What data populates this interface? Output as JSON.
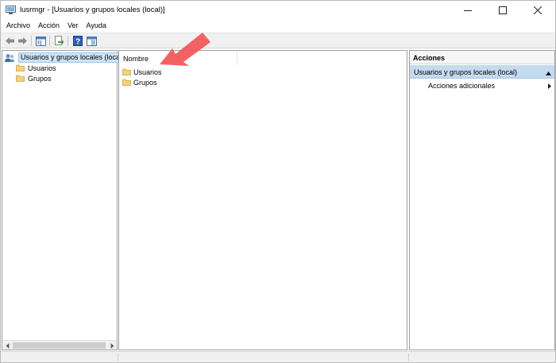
{
  "window": {
    "title": "lusrmgr - [Usuarios y grupos locales (local)]",
    "controls": {
      "minimize": "─",
      "maximize": "☐",
      "close": "✕"
    }
  },
  "menu": [
    "Archivo",
    "Acción",
    "Ver",
    "Ayuda"
  ],
  "toolbar": {
    "buttons": [
      "back-arrow-icon",
      "forward-arrow-icon",
      "show-hide-tree-icon",
      "export-list-icon",
      "help-icon",
      "action-pane-icon"
    ]
  },
  "tree": {
    "root": "Usuarios y grupos locales (local)",
    "children": [
      "Usuarios",
      "Grupos"
    ]
  },
  "list": {
    "column_name": "Nombre",
    "items": [
      "Usuarios",
      "Grupos"
    ]
  },
  "actions": {
    "header": "Acciones",
    "section": "Usuarios y grupos locales (local)",
    "items": [
      "Acciones adicionales"
    ]
  },
  "colors": {
    "selection": "#cde3f7",
    "actions_section": "#c4daee",
    "folder": "#f3d27a",
    "arrow": "#f25a5a"
  }
}
